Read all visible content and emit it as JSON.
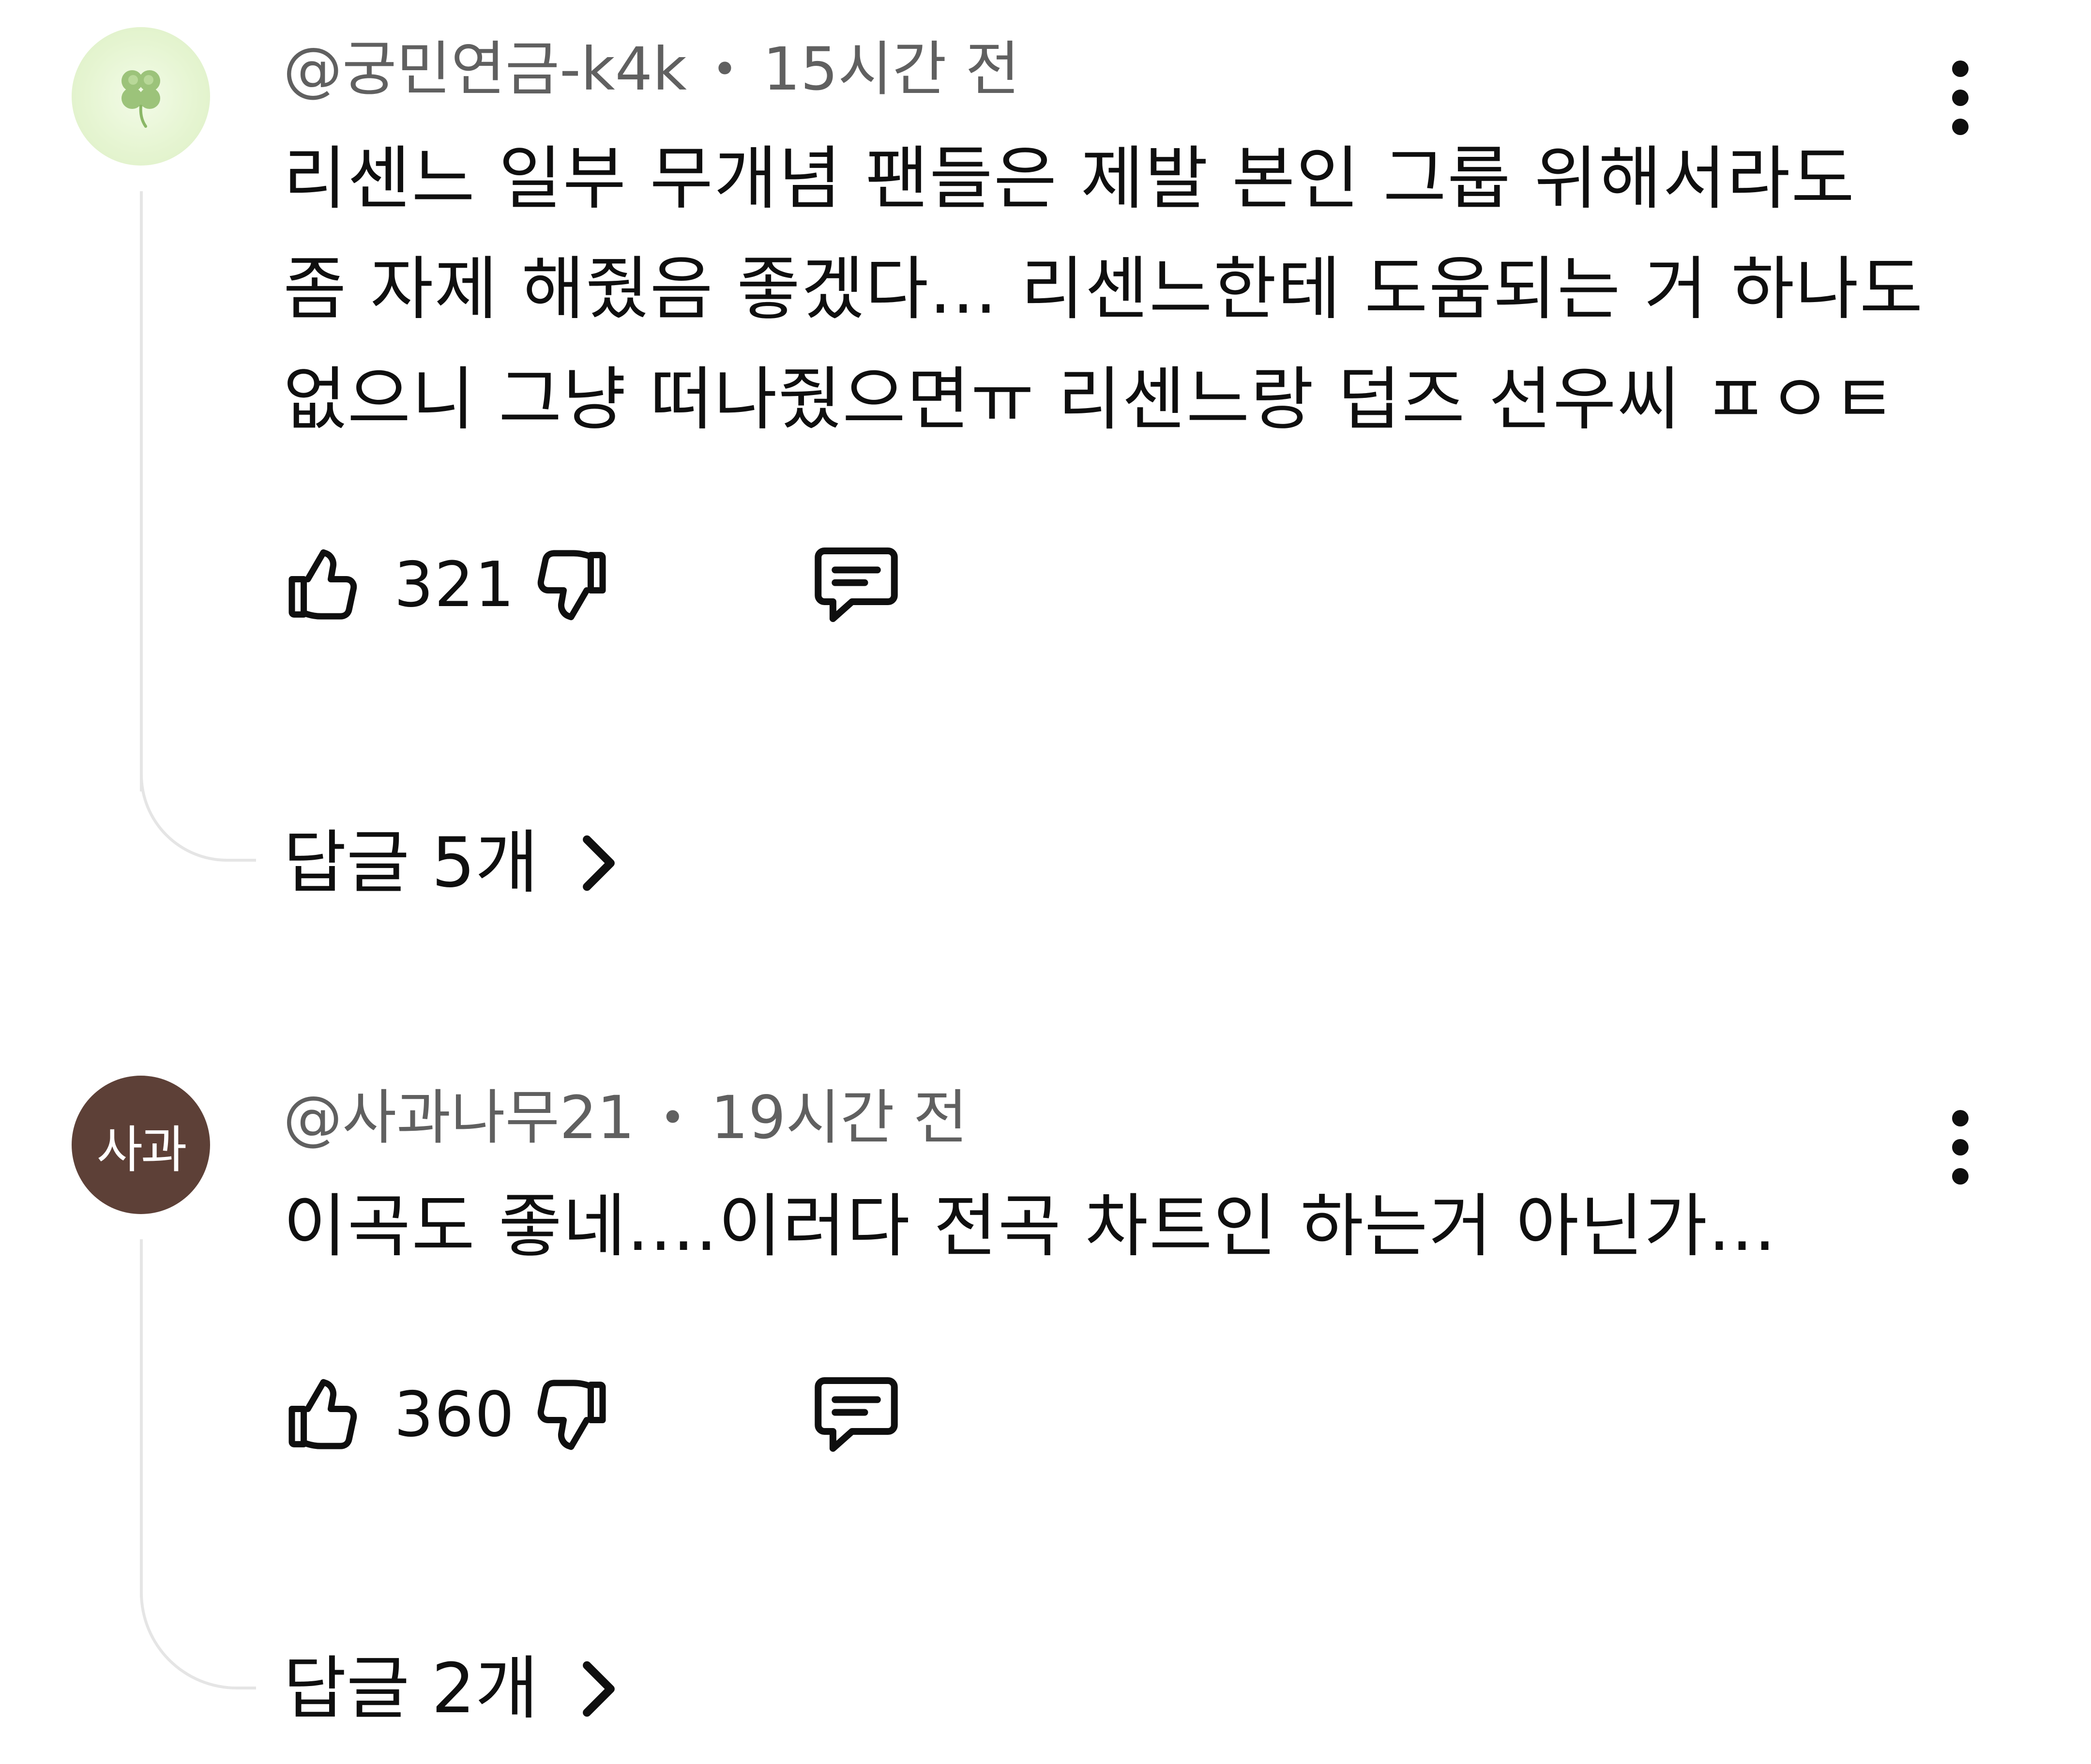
{
  "comments": [
    {
      "author": "@궁민연금-k4k",
      "time": "15시간 전",
      "avatar": {
        "type": "image",
        "icon": "clover-icon",
        "bg": "#e6f5d2"
      },
      "lines": [
        "리센느 일부 무개념 팬들은 제발 본인 그룹 위해서라도",
        "좀 자제 해줬음 좋겠다... 리센느한테 도움되는 거 하나도",
        "없으니 그냥 떠나줬으면ㅠ 리센느랑 덥즈 선우씨 ㅍㅇㅌ"
      ],
      "likes": "321",
      "replies_label": "답글 5개"
    },
    {
      "author": "@사과나무21",
      "time": "19시간 전",
      "avatar": {
        "type": "text",
        "text": "사과",
        "bg": "#5d4037"
      },
      "lines": [
        "이곡도 좋네....이러다 전곡 차트인 하는거 아닌가..."
      ],
      "likes": "360",
      "replies_label": "답글 2개"
    }
  ],
  "separator": "•",
  "icons": {
    "like": "thumbs-up-icon",
    "dislike": "thumbs-down-icon",
    "reply": "comment-icon",
    "more": "more-vertical-icon",
    "chevron": "chevron-right-icon"
  }
}
